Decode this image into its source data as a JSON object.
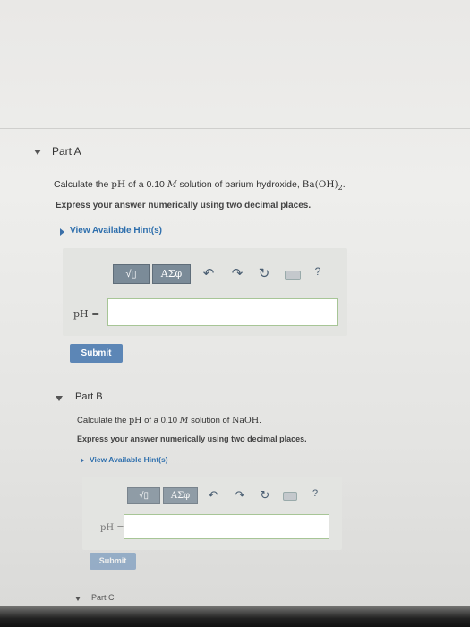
{
  "part_a": {
    "title": "Part A",
    "question_prefix": "Calculate the ",
    "question_ph": "pH",
    "question_mid": " of a 0.10 ",
    "question_molar": "M",
    "question_mid2": " solution of barium hydroxide, ",
    "question_formula": "Ba(OH)",
    "question_formula_sub": "2",
    "question_end": ".",
    "instruction": "Express your answer numerically using two decimal places.",
    "hint_label": "View Available Hint(s)",
    "toolbar": {
      "template_symbol": "√▯",
      "greek_label": "ΑΣφ",
      "undo_icon": "↶",
      "redo_icon": "↷",
      "reset_icon": "↻",
      "help_label": "?"
    },
    "input_label": "pH =",
    "input_value": "",
    "submit_label": "Submit"
  },
  "part_b": {
    "title": "Part B",
    "question_prefix": "Calculate the ",
    "question_ph": "pH",
    "question_mid": " of a 0.10 ",
    "question_molar": "M",
    "question_mid2": " solution of ",
    "question_formula": "NaOH",
    "question_end": ".",
    "instruction": "Express your answer numerically using two decimal places.",
    "hint_label": "View Available Hint(s)",
    "toolbar": {
      "template_symbol": "√▯",
      "greek_label": "ΑΣφ",
      "undo_icon": "↶",
      "redo_icon": "↷",
      "reset_icon": "↻",
      "help_label": "?"
    },
    "input_label": "pH =",
    "input_value": "",
    "submit_label": "Submit"
  },
  "part_c": {
    "title": "Part C"
  },
  "colors": {
    "hint_link": "#2e6fad",
    "submit_bg": "#5c86b6",
    "toolbar_button": "#7b8b98",
    "input_border": "#a7c596"
  }
}
